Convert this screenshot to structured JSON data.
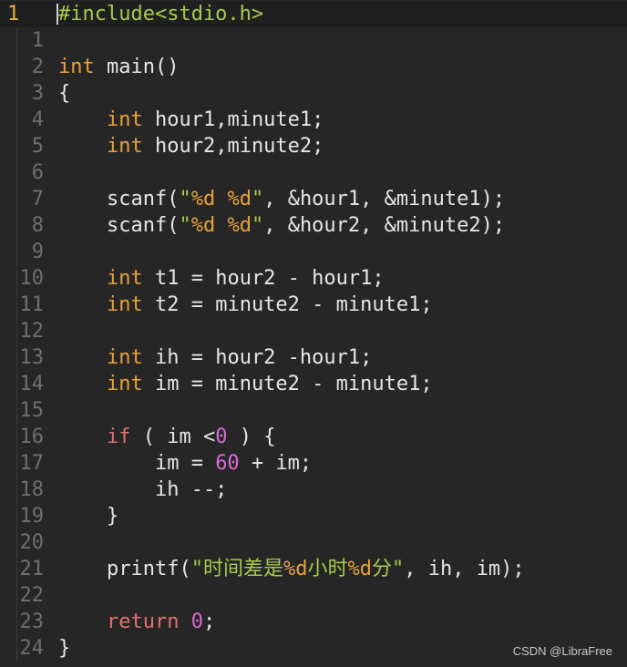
{
  "editor": {
    "language": "c",
    "current_line": 1,
    "lines": [
      {
        "no": "1",
        "tokens": [
          {
            "t": "#include<stdio.h>",
            "c": "pre"
          }
        ]
      },
      {
        "no": "1",
        "tokens": []
      },
      {
        "no": "2",
        "tokens": [
          {
            "t": "int",
            "c": "kw"
          },
          {
            "t": " main()",
            "c": ""
          }
        ]
      },
      {
        "no": "3",
        "tokens": [
          {
            "t": "{",
            "c": ""
          }
        ]
      },
      {
        "no": "4",
        "tokens": [
          {
            "t": "    ",
            "c": ""
          },
          {
            "t": "int",
            "c": "kw"
          },
          {
            "t": " hour1,minute1;",
            "c": ""
          }
        ]
      },
      {
        "no": "5",
        "tokens": [
          {
            "t": "    ",
            "c": ""
          },
          {
            "t": "int",
            "c": "kw"
          },
          {
            "t": " hour2,minute2;",
            "c": ""
          }
        ]
      },
      {
        "no": "6",
        "tokens": []
      },
      {
        "no": "7",
        "tokens": [
          {
            "t": "    scanf(",
            "c": ""
          },
          {
            "t": "\"",
            "c": "str"
          },
          {
            "t": "%d",
            "c": "fmt"
          },
          {
            "t": " ",
            "c": "str"
          },
          {
            "t": "%d",
            "c": "fmt"
          },
          {
            "t": "\"",
            "c": "str"
          },
          {
            "t": ", &hour1, &minute1);",
            "c": ""
          }
        ]
      },
      {
        "no": "8",
        "tokens": [
          {
            "t": "    scanf(",
            "c": ""
          },
          {
            "t": "\"",
            "c": "str"
          },
          {
            "t": "%d",
            "c": "fmt"
          },
          {
            "t": " ",
            "c": "str"
          },
          {
            "t": "%d",
            "c": "fmt"
          },
          {
            "t": "\"",
            "c": "str"
          },
          {
            "t": ", &hour2, &minute2);",
            "c": ""
          }
        ]
      },
      {
        "no": "9",
        "tokens": []
      },
      {
        "no": "10",
        "tokens": [
          {
            "t": "    ",
            "c": ""
          },
          {
            "t": "int",
            "c": "kw"
          },
          {
            "t": " t1 = hour2 - hour1;",
            "c": ""
          }
        ]
      },
      {
        "no": "11",
        "tokens": [
          {
            "t": "    ",
            "c": ""
          },
          {
            "t": "int",
            "c": "kw"
          },
          {
            "t": " t2 = minute2 - minute1;",
            "c": ""
          }
        ]
      },
      {
        "no": "12",
        "tokens": []
      },
      {
        "no": "13",
        "tokens": [
          {
            "t": "    ",
            "c": ""
          },
          {
            "t": "int",
            "c": "kw"
          },
          {
            "t": " ih = hour2 -hour1;",
            "c": ""
          }
        ]
      },
      {
        "no": "14",
        "tokens": [
          {
            "t": "    ",
            "c": ""
          },
          {
            "t": "int",
            "c": "kw"
          },
          {
            "t": " im = minute2 - minute1;",
            "c": ""
          }
        ]
      },
      {
        "no": "15",
        "tokens": []
      },
      {
        "no": "16",
        "tokens": [
          {
            "t": "    ",
            "c": ""
          },
          {
            "t": "if",
            "c": "ret"
          },
          {
            "t": " ( im <",
            "c": ""
          },
          {
            "t": "0",
            "c": "num"
          },
          {
            "t": " ) {",
            "c": ""
          }
        ]
      },
      {
        "no": "17",
        "tokens": [
          {
            "t": "        im = ",
            "c": ""
          },
          {
            "t": "60",
            "c": "num"
          },
          {
            "t": " + im;",
            "c": ""
          }
        ]
      },
      {
        "no": "18",
        "tokens": [
          {
            "t": "        ih --;",
            "c": ""
          }
        ]
      },
      {
        "no": "19",
        "tokens": [
          {
            "t": "    }",
            "c": ""
          }
        ]
      },
      {
        "no": "20",
        "tokens": []
      },
      {
        "no": "21",
        "tokens": [
          {
            "t": "    printf(",
            "c": ""
          },
          {
            "t": "\"时间差是",
            "c": "str"
          },
          {
            "t": "%d",
            "c": "fmt"
          },
          {
            "t": "小时",
            "c": "str"
          },
          {
            "t": "%d",
            "c": "fmt"
          },
          {
            "t": "分\"",
            "c": "str"
          },
          {
            "t": ", ih, im);",
            "c": ""
          }
        ]
      },
      {
        "no": "22",
        "tokens": []
      },
      {
        "no": "23",
        "tokens": [
          {
            "t": "    ",
            "c": ""
          },
          {
            "t": "return",
            "c": "ret"
          },
          {
            "t": " ",
            "c": ""
          },
          {
            "t": "0",
            "c": "num"
          },
          {
            "t": ";",
            "c": ""
          }
        ]
      },
      {
        "no": "24",
        "tokens": [
          {
            "t": "}",
            "c": ""
          }
        ]
      }
    ]
  },
  "colors": {
    "background": "#262626",
    "keyword": "#e8a13a",
    "return_keyword": "#e07070",
    "number": "#d96ad3",
    "string": "#a8c94c",
    "text": "#e6e6e6",
    "line_number": "#6e6e6e",
    "current_line_number": "#e8b23a"
  },
  "watermark": {
    "text": "CSDN @LibraFree"
  }
}
